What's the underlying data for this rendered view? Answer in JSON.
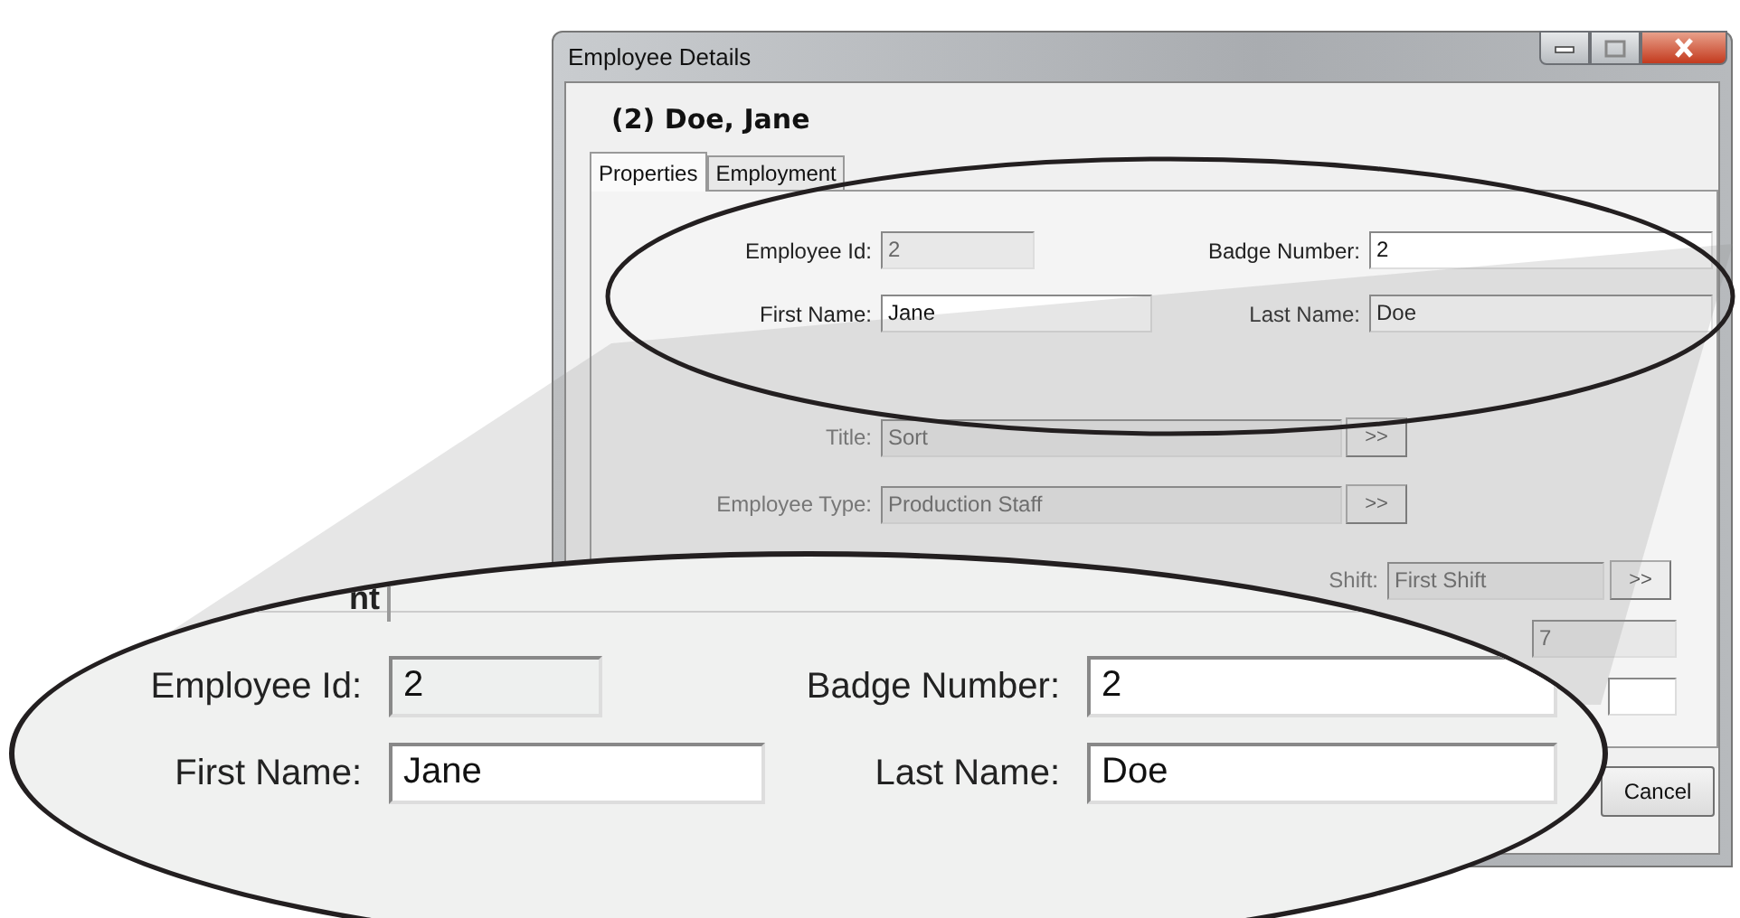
{
  "window": {
    "title": "Employee Details"
  },
  "header": "(2) Doe, Jane",
  "tabs": [
    {
      "label": "Properties",
      "selected": true
    },
    {
      "label": "Employment",
      "selected": false
    }
  ],
  "properties_fields": [
    {
      "label": "Employee Id:",
      "value": "2",
      "disabled": true
    },
    {
      "label": "Badge Number:",
      "value": "2",
      "disabled": false
    },
    {
      "label": "First Name:",
      "value": "Jane",
      "disabled": false
    },
    {
      "label": "Last Name:",
      "value": "Doe",
      "disabled": false
    }
  ],
  "lookup_fields": [
    {
      "label": "Title:",
      "value": "Sort",
      "button": ">>",
      "disabled": true
    },
    {
      "label": "Employee Type:",
      "value": "Production Staff",
      "button": ">>",
      "disabled": true
    }
  ],
  "shift": {
    "label": "Shift:",
    "value": "First Shift",
    "button": ">>",
    "disabled": true
  },
  "extra_fields": [
    {
      "value": "7",
      "disabled": true
    },
    {
      "disabled": false
    }
  ],
  "buttons": [
    "Cancel"
  ],
  "magnified": {
    "tab_fragment": "nt",
    "fields": [
      {
        "label": "Employee Id:",
        "value": "2",
        "disabled": true
      },
      {
        "label": "Badge Number:",
        "value": "2",
        "disabled": false
      },
      {
        "label": "First Name:",
        "value": "Jane",
        "disabled": false
      },
      {
        "label": "Last Name:",
        "value": "Doe",
        "disabled": false
      }
    ]
  }
}
